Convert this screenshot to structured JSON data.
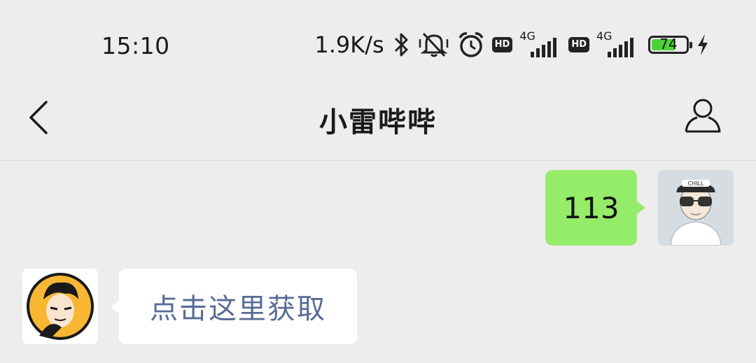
{
  "status_bar": {
    "time": "15:10",
    "net_speed": "1.9K/s",
    "icons": [
      "bluetooth-icon",
      "mute-icon",
      "alarm-icon",
      "hd-icon",
      "signal-icon",
      "hd-icon",
      "signal-icon",
      "battery-icon",
      "charging-icon"
    ],
    "hd_label": "HD",
    "network_label": "4G",
    "battery_level": "74",
    "battery_fraction": 0.74
  },
  "nav": {
    "title": "小雷哔哔",
    "back_icon": "chevron-left-icon",
    "profile_icon": "person-icon"
  },
  "messages": [
    {
      "direction": "outgoing",
      "text": "113",
      "bubble_color": "#95ec69"
    },
    {
      "direction": "incoming",
      "text": "点击这里获取",
      "bubble_color": "#ffffff",
      "text_color": "#576b95"
    }
  ],
  "colors": {
    "background": "#ededed",
    "outgoing_bubble": "#95ec69",
    "incoming_bubble": "#ffffff",
    "link_text": "#576b95"
  }
}
